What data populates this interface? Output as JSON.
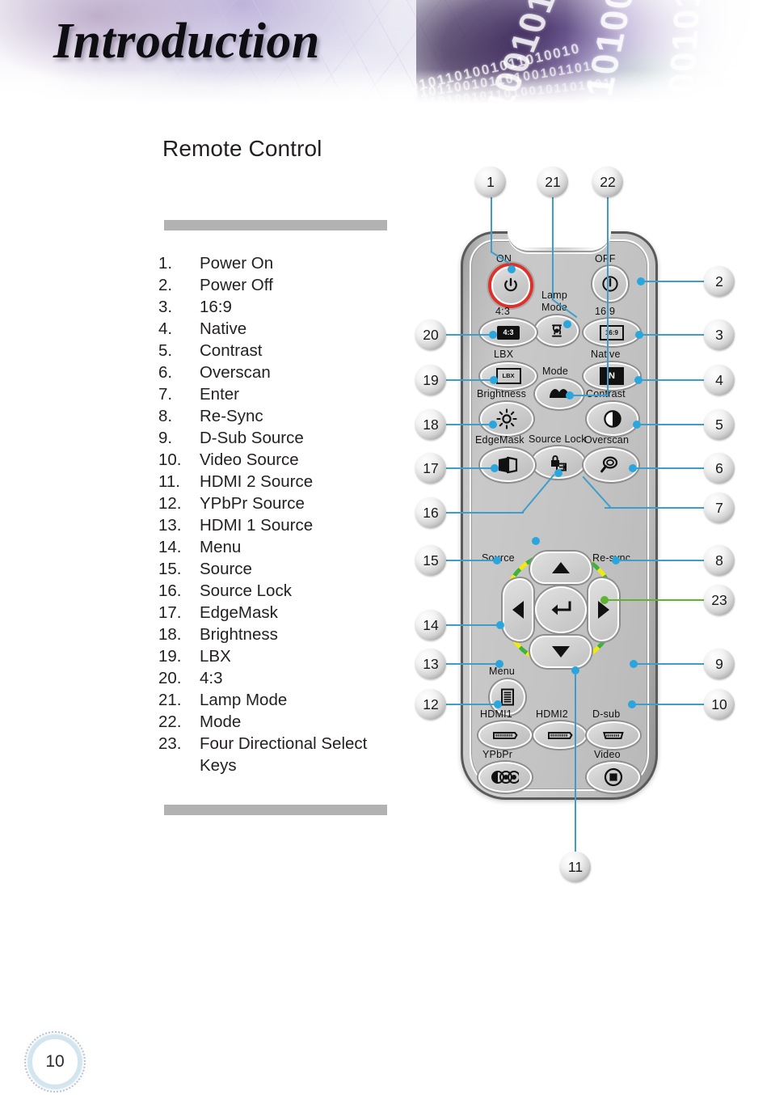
{
  "banner": {
    "title": "Introduction",
    "binary_rows": [
      "1001010010",
      "0101001001",
      "1001011010",
      "0101101001011010010",
      "1010110010110100101101",
      "01011010010110100101101001"
    ]
  },
  "page": {
    "number": "10"
  },
  "content": {
    "section_title": "Remote Control",
    "list": [
      {
        "num": "1.",
        "label": "Power On"
      },
      {
        "num": "2.",
        "label": "Power Off"
      },
      {
        "num": "3.",
        "label": "16:9"
      },
      {
        "num": "4.",
        "label": "Native"
      },
      {
        "num": "5.",
        "label": "Contrast"
      },
      {
        "num": "6.",
        "label": "Overscan"
      },
      {
        "num": "7.",
        "label": "Enter"
      },
      {
        "num": "8.",
        "label": "Re-Sync"
      },
      {
        "num": "9.",
        "label": "D-Sub Source"
      },
      {
        "num": "10.",
        "label": "Video Source"
      },
      {
        "num": "11.",
        "label": "HDMI 2 Source"
      },
      {
        "num": "12.",
        "label": "YPbPr Source"
      },
      {
        "num": "13.",
        "label": "HDMI 1 Source"
      },
      {
        "num": "14.",
        "label": "Menu"
      },
      {
        "num": "15.",
        "label": "Source"
      },
      {
        "num": "16.",
        "label": "Source Lock"
      },
      {
        "num": "17.",
        "label": "EdgeMask"
      },
      {
        "num": "18.",
        "label": "Brightness"
      },
      {
        "num": "19.",
        "label": "LBX"
      },
      {
        "num": "20.",
        "label": "4:3"
      },
      {
        "num": "21.",
        "label": "Lamp Mode"
      },
      {
        "num": "22.",
        "label": "Mode"
      },
      {
        "num": "23.",
        "label": "Four Directional Select",
        "cont": "Keys"
      }
    ]
  },
  "remote": {
    "labels": {
      "on": "ON",
      "off": "OFF",
      "lamp": "Lamp",
      "lamp_mode": "Mode",
      "ratio_43": "4:3",
      "ratio_169": "16:9",
      "lbx": "LBX",
      "native": "Native",
      "brightness": "Brightness",
      "mode": "Mode",
      "contrast": "Contrast",
      "edgemask": "EdgeMask",
      "source_lock": "Source Lock",
      "overscan": "Overscan",
      "source": "Source",
      "resync": "Re-sync",
      "menu": "Menu",
      "hdmi1": "HDMI1",
      "hdmi2": "HDMI2",
      "dsub": "D-sub",
      "ypbpr": "YPbPr",
      "video": "Video"
    },
    "key_glyphs": {
      "ratio_43": "4:3",
      "ratio_169": "16:9",
      "lbx": "LBX",
      "native": "N"
    },
    "colors": {
      "power_ring": "#e0302a",
      "leader": "#3e9ec9",
      "dpad_green": "#3db33d",
      "dpad_yellow": "#f4e90c"
    },
    "callouts": [
      {
        "id": "1",
        "side": "top"
      },
      {
        "id": "21",
        "side": "top"
      },
      {
        "id": "22",
        "side": "top"
      },
      {
        "id": "2",
        "side": "right"
      },
      {
        "id": "3",
        "side": "right"
      },
      {
        "id": "4",
        "side": "right"
      },
      {
        "id": "5",
        "side": "right"
      },
      {
        "id": "6",
        "side": "right"
      },
      {
        "id": "7",
        "side": "right"
      },
      {
        "id": "8",
        "side": "right"
      },
      {
        "id": "23",
        "side": "right"
      },
      {
        "id": "9",
        "side": "right"
      },
      {
        "id": "10",
        "side": "right"
      },
      {
        "id": "20",
        "side": "left"
      },
      {
        "id": "19",
        "side": "left"
      },
      {
        "id": "18",
        "side": "left"
      },
      {
        "id": "17",
        "side": "left"
      },
      {
        "id": "16",
        "side": "left"
      },
      {
        "id": "15",
        "side": "left"
      },
      {
        "id": "14",
        "side": "left"
      },
      {
        "id": "13",
        "side": "left"
      },
      {
        "id": "12",
        "side": "left"
      },
      {
        "id": "11",
        "side": "bottom"
      }
    ]
  }
}
